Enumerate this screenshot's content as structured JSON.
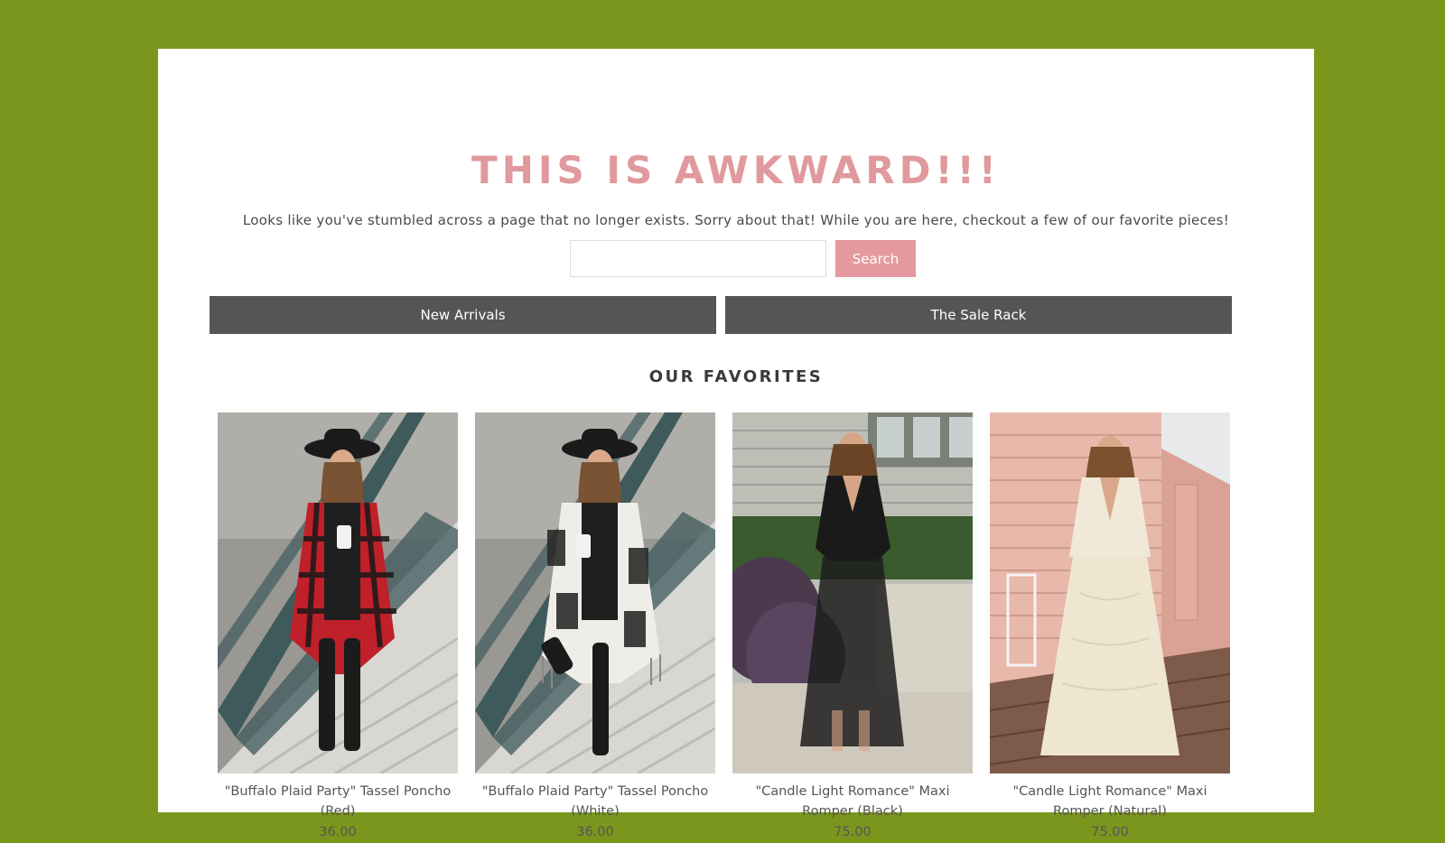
{
  "page": {
    "headline": "THIS IS AWKWARD!!!",
    "intro": "Looks like you've stumbled across a page that no longer exists. Sorry about that! While you are here, checkout a few of our favorite pieces!"
  },
  "search": {
    "value": "",
    "placeholder": "",
    "button_label": "Search"
  },
  "nav": {
    "new_arrivals_label": "New Arrivals",
    "sale_rack_label": "The Sale Rack"
  },
  "favorites": {
    "title": "OUR FAVORITES",
    "products": [
      {
        "name_line1": "\"Buffalo Plaid Party\" Tassel Poncho",
        "name_line2": "(Red)",
        "price": "36.00"
      },
      {
        "name_line1": "\"Buffalo Plaid Party\" Tassel Poncho",
        "name_line2": "(White)",
        "price": "36.00"
      },
      {
        "name_line1": "\"Candle Light Romance\" Maxi",
        "name_line2": "Romper (Black)",
        "price": "75.00"
      },
      {
        "name_line1": "\"Candle Light Romance\" Maxi",
        "name_line2": "Romper (Natural)",
        "price": "75.00"
      }
    ]
  },
  "colors": {
    "background": "#7b961c",
    "accent_pink": "#e4999e",
    "nav_gray": "#555555"
  }
}
